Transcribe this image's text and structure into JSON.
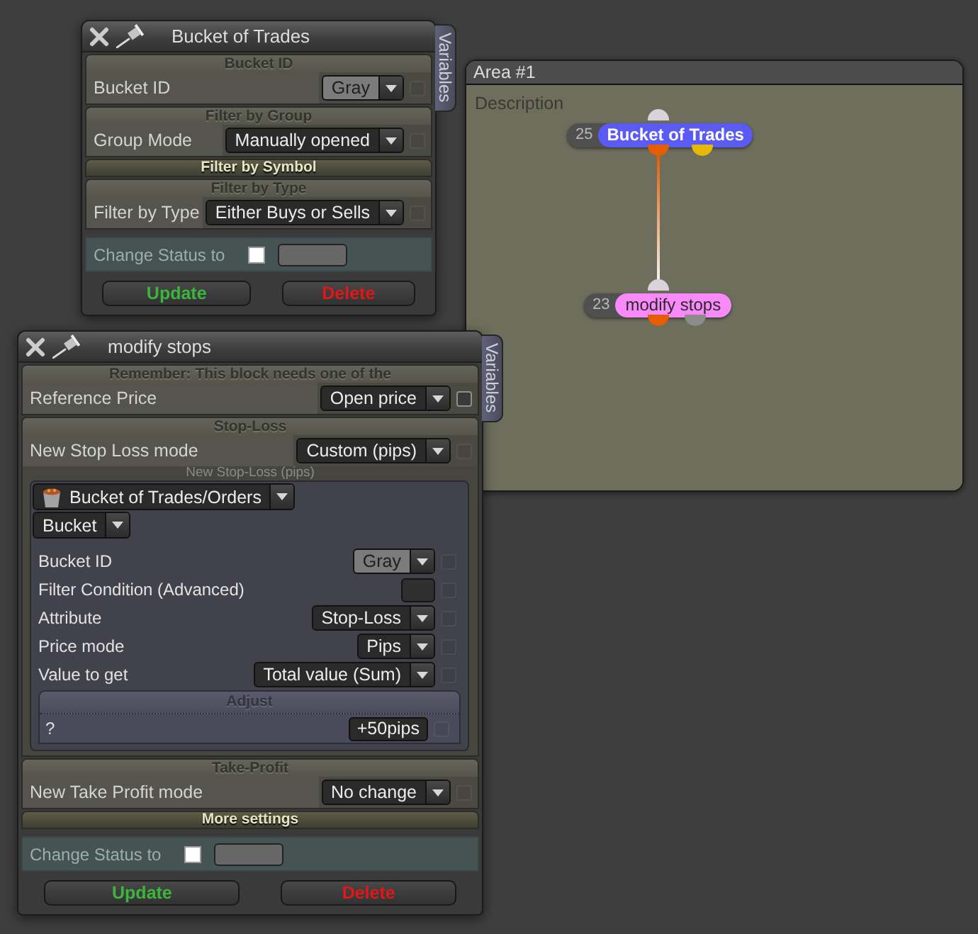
{
  "windows": [
    {
      "title": "Bucket of Trades",
      "side_tab": "Variables",
      "sections": [
        {
          "title": "Bucket ID",
          "expanded": true,
          "rows": [
            {
              "kind": "select",
              "label": "Bucket ID",
              "value": "Gray",
              "color": "#7b7b7b",
              "checked": false,
              "checkbox_disabled": true
            }
          ]
        },
        {
          "title": "Filter by Group",
          "expanded": true,
          "rows": [
            {
              "kind": "select",
              "label": "Group Mode",
              "value": "Manually opened",
              "checked": false,
              "checkbox_disabled": true
            }
          ]
        },
        {
          "title": "Filter by Symbol",
          "expanded": false
        },
        {
          "title": "Filter by Type",
          "expanded": true,
          "rows": [
            {
              "kind": "select",
              "label": "Filter by Type",
              "value": "Either Buys or Sells",
              "checked": false,
              "checkbox_disabled": true
            }
          ]
        }
      ],
      "status": {
        "label": "Change Status to",
        "checked": false
      },
      "buttons": [
        {
          "kind": "update",
          "label": "Update"
        },
        {
          "kind": "delete",
          "label": "Delete"
        }
      ]
    },
    {
      "title": "modify stops",
      "side_tab": "Variables",
      "sections": [
        {
          "title": "Remember: This block needs one of the",
          "expanded": true,
          "rows": [
            {
              "kind": "select",
              "label": "Reference Price",
              "value": "Open price",
              "checked": false,
              "checkbox_disabled": false
            }
          ]
        },
        {
          "title": "Stop-Loss",
          "expanded": true,
          "rows": [
            {
              "kind": "select",
              "label": "New Stop Loss mode",
              "value": "Custom (pips)",
              "checked": false,
              "checkbox_disabled": true
            },
            {
              "kind": "note",
              "label": "New Stop-Loss (pips)"
            },
            {
              "kind": "panel",
              "source": "Bucket of Trades/Orders",
              "mode": "Bucket",
              "rows": [
                {
                  "kind": "select",
                  "label": "Bucket ID",
                  "value": "Gray",
                  "color": "#7b7b7b",
                  "checked": false,
                  "checkbox_disabled": true
                },
                {
                  "kind": "field",
                  "label": "Filter Condition (Advanced)",
                  "checked": false,
                  "checkbox_disabled": true
                },
                {
                  "kind": "select",
                  "label": "Attribute",
                  "value": "Stop-Loss",
                  "checked": false,
                  "checkbox_disabled": true
                },
                {
                  "kind": "select",
                  "label": "Price mode",
                  "value": "Pips",
                  "checked": false,
                  "checkbox_disabled": true
                },
                {
                  "kind": "select",
                  "label": "Value to get",
                  "value": "Total value (Sum)",
                  "checked": false,
                  "checkbox_disabled": true
                },
                {
                  "kind": "group",
                  "title": "Adjust",
                  "rows": [
                    {
                      "kind": "input",
                      "label": "?",
                      "value": "+50pips",
                      "checked": false,
                      "checkbox_disabled": true
                    }
                  ]
                }
              ]
            }
          ]
        },
        {
          "title": "Take-Profit",
          "expanded": true,
          "rows": [
            {
              "kind": "select",
              "label": "New Take Profit mode",
              "value": "No change",
              "checked": false,
              "checkbox_disabled": true
            }
          ]
        },
        {
          "title": "More settings",
          "expanded": false
        }
      ],
      "status": {
        "label": "Change Status to",
        "checked": false
      },
      "buttons": [
        {
          "kind": "update",
          "label": "Update"
        },
        {
          "kind": "delete",
          "label": "Delete"
        }
      ]
    }
  ],
  "area": {
    "title": "Area #1",
    "description": "Description",
    "nodes": [
      {
        "number": "25",
        "label": "Bucket of Trades",
        "color": "#5a5af5",
        "selected": true,
        "inputs": [
          {
            "color": "#dcd2dc"
          }
        ],
        "outputs": [
          {
            "color": "#e65c00",
            "connected": true
          },
          {
            "color": "#e6b800",
            "connected": false
          }
        ]
      },
      {
        "number": "23",
        "label": "modify stops",
        "color": "#f889f8",
        "selected": false,
        "inputs": [
          {
            "color": "#dcd2dc"
          }
        ],
        "outputs": [
          {
            "color": "#e65c00",
            "connected": false
          },
          {
            "color": "#8c8c8c",
            "connected": false
          }
        ]
      }
    ]
  }
}
